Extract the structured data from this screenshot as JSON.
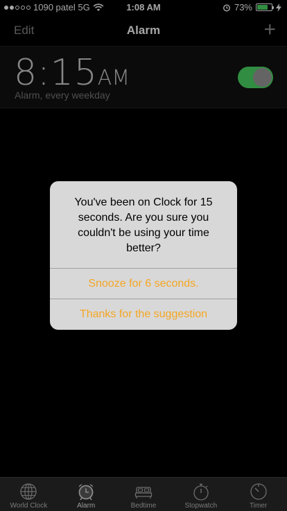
{
  "status_bar": {
    "carrier": "1090 patel 5G",
    "time": "1:08 AM",
    "battery": "73%",
    "battery_level": 0.73
  },
  "nav": {
    "edit_label": "Edit",
    "title": "Alarm",
    "add_label": "+"
  },
  "alarm": {
    "time": "8:15",
    "ampm": "AM",
    "label": "Alarm, every weekday",
    "enabled": true
  },
  "alert": {
    "message": "You've been on Clock for 15 seconds. Are you sure you couldn't be using your time better?",
    "buttons": [
      {
        "label": "Snooze for 6 seconds."
      },
      {
        "label": "Thanks for the suggestion"
      }
    ]
  },
  "tabs": [
    {
      "label": "World Clock",
      "icon": "globe-icon"
    },
    {
      "label": "Alarm",
      "icon": "alarm-clock-icon"
    },
    {
      "label": "Bedtime",
      "icon": "bed-icon"
    },
    {
      "label": "Stopwatch",
      "icon": "stopwatch-icon"
    },
    {
      "label": "Timer",
      "icon": "timer-icon"
    }
  ],
  "colors": {
    "accent": "#f5a623",
    "toggle_on": "#4cd964",
    "background": "#000000"
  }
}
